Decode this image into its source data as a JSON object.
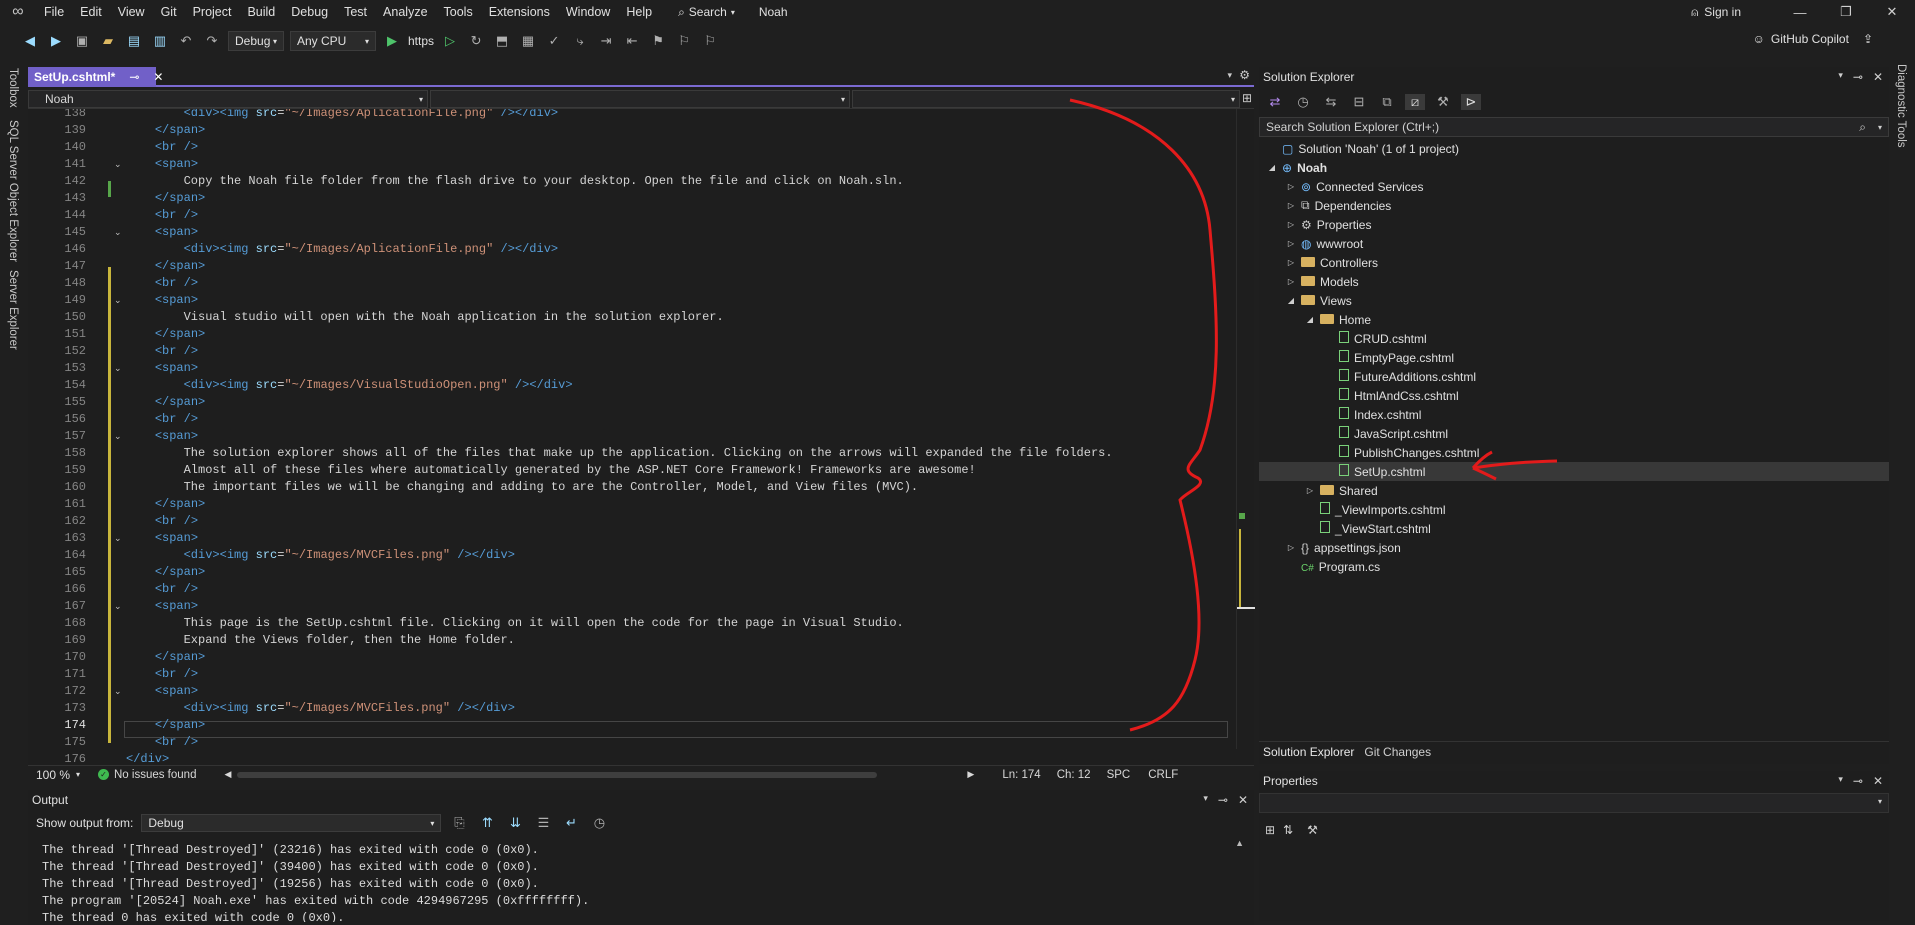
{
  "menu": {
    "items": [
      "File",
      "Edit",
      "View",
      "Git",
      "Project",
      "Build",
      "Debug",
      "Test",
      "Analyze",
      "Tools",
      "Extensions",
      "Window",
      "Help"
    ],
    "search_label": "Search",
    "solution_name": "Noah",
    "sign_in": "Sign in"
  },
  "toolbar": {
    "config": "Debug",
    "platform": "Any CPU",
    "run_target": "https",
    "copilot": "GitHub Copilot"
  },
  "side_tabs": {
    "toolbox": "Toolbox",
    "sql": "SQL Server Object Explorer",
    "server": "Server Explorer",
    "diagnostic": "Diagnostic Tools"
  },
  "editor": {
    "tab_title": "SetUp.cshtml*",
    "nav_project": "Noah",
    "zoom": "100 %",
    "issues": "No issues found",
    "ln": "Ln: 174",
    "ch": "Ch: 12",
    "spc": "SPC",
    "crlf": "CRLF",
    "lines": [
      {
        "n": "138",
        "t": "        <div><img src=\"~/Images/AplicationFile.png\" /></div>"
      },
      {
        "n": "139",
        "t": "    </span>"
      },
      {
        "n": "140",
        "t": "    <br />"
      },
      {
        "n": "141",
        "t": "    <span>"
      },
      {
        "n": "142",
        "t": "        Copy the Noah file folder from the flash drive to your desktop. Open the file and click on Noah.sln."
      },
      {
        "n": "143",
        "t": "    </span>"
      },
      {
        "n": "144",
        "t": "    <br />"
      },
      {
        "n": "145",
        "t": "    <span>"
      },
      {
        "n": "146",
        "t": "        <div><img src=\"~/Images/AplicationFile.png\" /></div>"
      },
      {
        "n": "147",
        "t": "    </span>"
      },
      {
        "n": "148",
        "t": "    <br />"
      },
      {
        "n": "149",
        "t": "    <span>"
      },
      {
        "n": "150",
        "t": "        Visual studio will open with the Noah application in the solution explorer."
      },
      {
        "n": "151",
        "t": "    </span>"
      },
      {
        "n": "152",
        "t": "    <br />"
      },
      {
        "n": "153",
        "t": "    <span>"
      },
      {
        "n": "154",
        "t": "        <div><img src=\"~/Images/VisualStudioOpen.png\" /></div>"
      },
      {
        "n": "155",
        "t": "    </span>"
      },
      {
        "n": "156",
        "t": "    <br />"
      },
      {
        "n": "157",
        "t": "    <span>"
      },
      {
        "n": "158",
        "t": "        The solution explorer shows all of the files that make up the application. Clicking on the arrows will expanded the file folders."
      },
      {
        "n": "159",
        "t": "        Almost all of these files where automatically generated by the ASP.NET Core Framework! Frameworks are awesome!"
      },
      {
        "n": "160",
        "t": "        The important files we will be changing and adding to are the Controller, Model, and View files (MVC)."
      },
      {
        "n": "161",
        "t": "    </span>"
      },
      {
        "n": "162",
        "t": "    <br />"
      },
      {
        "n": "163",
        "t": "    <span>"
      },
      {
        "n": "164",
        "t": "        <div><img src=\"~/Images/MVCFiles.png\" /></div>"
      },
      {
        "n": "165",
        "t": "    </span>"
      },
      {
        "n": "166",
        "t": "    <br />"
      },
      {
        "n": "167",
        "t": "    <span>"
      },
      {
        "n": "168",
        "t": "        This page is the SetUp.cshtml file. Clicking on it will open the code for the page in Visual Studio."
      },
      {
        "n": "169",
        "t": "        Expand the Views folder, then the Home folder."
      },
      {
        "n": "170",
        "t": "    </span>"
      },
      {
        "n": "171",
        "t": "    <br />"
      },
      {
        "n": "172",
        "t": "    <span>"
      },
      {
        "n": "173",
        "t": "        <div><img src=\"~/Images/MVCFiles.png\" /></div>"
      },
      {
        "n": "174",
        "t": "    </span>"
      },
      {
        "n": "175",
        "t": "    <br />"
      },
      {
        "n": "176",
        "t": "</div>"
      }
    ]
  },
  "solution_explorer": {
    "title": "Solution Explorer",
    "search_placeholder": "Search Solution Explorer (Ctrl+;)",
    "tree": [
      {
        "label": "Solution 'Noah' (1 of 1 project)",
        "depth": 0,
        "icon": "solution-icon",
        "arrow": ""
      },
      {
        "label": "Noah",
        "depth": 0,
        "icon": "project-icon",
        "arrow": "open",
        "bold": true
      },
      {
        "label": "Connected Services",
        "depth": 1,
        "icon": "connected-services-icon",
        "arrow": "closed"
      },
      {
        "label": "Dependencies",
        "depth": 1,
        "icon": "dependencies-icon",
        "arrow": "closed"
      },
      {
        "label": "Properties",
        "depth": 1,
        "icon": "properties-icon",
        "arrow": "closed"
      },
      {
        "label": "wwwroot",
        "depth": 1,
        "icon": "globe-icon",
        "arrow": "closed"
      },
      {
        "label": "Controllers",
        "depth": 1,
        "icon": "folder-icon",
        "arrow": "closed"
      },
      {
        "label": "Models",
        "depth": 1,
        "icon": "folder-icon",
        "arrow": "closed"
      },
      {
        "label": "Views",
        "depth": 1,
        "icon": "folder-icon",
        "arrow": "open"
      },
      {
        "label": "Home",
        "depth": 2,
        "icon": "folder-icon",
        "arrow": "open"
      },
      {
        "label": "CRUD.cshtml",
        "depth": 3,
        "icon": "razor-file-icon",
        "arrow": ""
      },
      {
        "label": "EmptyPage.cshtml",
        "depth": 3,
        "icon": "razor-file-icon",
        "arrow": ""
      },
      {
        "label": "FutureAdditions.cshtml",
        "depth": 3,
        "icon": "razor-file-icon",
        "arrow": ""
      },
      {
        "label": "HtmlAndCss.cshtml",
        "depth": 3,
        "icon": "razor-file-icon",
        "arrow": ""
      },
      {
        "label": "Index.cshtml",
        "depth": 3,
        "icon": "razor-file-icon",
        "arrow": ""
      },
      {
        "label": "JavaScript.cshtml",
        "depth": 3,
        "icon": "razor-file-icon",
        "arrow": ""
      },
      {
        "label": "PublishChanges.cshtml",
        "depth": 3,
        "icon": "razor-file-icon",
        "arrow": ""
      },
      {
        "label": "SetUp.cshtml",
        "depth": 3,
        "icon": "razor-file-icon",
        "arrow": "",
        "selected": true
      },
      {
        "label": "Shared",
        "depth": 2,
        "icon": "folder-icon",
        "arrow": "closed"
      },
      {
        "label": "_ViewImports.cshtml",
        "depth": 2,
        "icon": "razor-file-icon",
        "arrow": ""
      },
      {
        "label": "_ViewStart.cshtml",
        "depth": 2,
        "icon": "razor-file-icon",
        "arrow": ""
      },
      {
        "label": "appsettings.json",
        "depth": 1,
        "icon": "json-file-icon",
        "arrow": "closed"
      },
      {
        "label": "Program.cs",
        "depth": 1,
        "icon": "csharp-file-icon",
        "arrow": ""
      }
    ],
    "tabs": [
      "Solution Explorer",
      "Git Changes"
    ]
  },
  "properties": {
    "title": "Properties"
  },
  "output": {
    "title": "Output",
    "show_from_label": "Show output from:",
    "source": "Debug",
    "lines": [
      "The thread '[Thread Destroyed]' (23216) has exited with code 0 (0x0).",
      "The thread '[Thread Destroyed]' (39400) has exited with code 0 (0x0).",
      "The thread '[Thread Destroyed]' (19256) has exited with code 0 (0x0).",
      "The program '[20524] Noah.exe' has exited with code 4294967295 (0xffffffff).",
      "The thread 0 has exited with code 0 (0x0)."
    ]
  },
  "colors": {
    "accent": "#7160c8",
    "annotation": "#e31b1b"
  }
}
